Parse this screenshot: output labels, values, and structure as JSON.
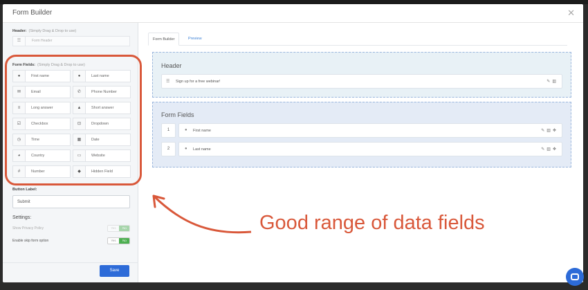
{
  "modal": {
    "title": "Form Builder"
  },
  "sidebar": {
    "header_label": "Header:",
    "header_hint": "(Simply Drag & Drop to use)",
    "header_item": {
      "icon": "list-icon",
      "label": "Form Header"
    },
    "fields_label": "Form Fields:",
    "fields_hint": "(Simply Drag & Drop to use)",
    "fields": [
      {
        "icon": "person-icon",
        "label": "First name"
      },
      {
        "icon": "person-icon",
        "label": "Last name"
      },
      {
        "icon": "envelope-icon",
        "label": "Email"
      },
      {
        "icon": "phone-icon",
        "label": "Phone Number"
      },
      {
        "icon": "lines-icon",
        "label": "Long answer"
      },
      {
        "icon": "text-icon",
        "label": "Short answer"
      },
      {
        "icon": "checkbox-icon",
        "label": "Checkbox"
      },
      {
        "icon": "dropdown-icon",
        "label": "Dropdown"
      },
      {
        "icon": "clock-icon",
        "label": "Time"
      },
      {
        "icon": "calendar-icon",
        "label": "Date"
      },
      {
        "icon": "globe-icon",
        "label": "Country"
      },
      {
        "icon": "monitor-icon",
        "label": "Website"
      },
      {
        "icon": "hash-icon",
        "label": "Number"
      },
      {
        "icon": "hidden-icon",
        "label": "Hidden Field"
      }
    ],
    "button_label": "Button Label:",
    "button_value": "Submit",
    "settings_title": "Settings:",
    "settings": [
      {
        "label": "Show Privacy Policy",
        "no": "Yes",
        "yes": "No"
      },
      {
        "label": "Enable skip form option",
        "no": "Yes",
        "yes": "No"
      }
    ],
    "save_label": "Save"
  },
  "main": {
    "tabs": [
      {
        "label": "Form Builder"
      },
      {
        "label": "Preview"
      }
    ],
    "header_section": {
      "title": "Header",
      "item": "Sign up for a free webinar!"
    },
    "fields_section": {
      "title": "Form Fields",
      "rows": [
        {
          "num": "1",
          "label": "First name"
        },
        {
          "num": "2",
          "label": "Last name"
        }
      ]
    }
  },
  "annotation": {
    "text": "Good range of data fields",
    "color": "#d9583a"
  },
  "colors": {
    "primary": "#2d6bd8",
    "toggle_on": "#4caf50"
  }
}
